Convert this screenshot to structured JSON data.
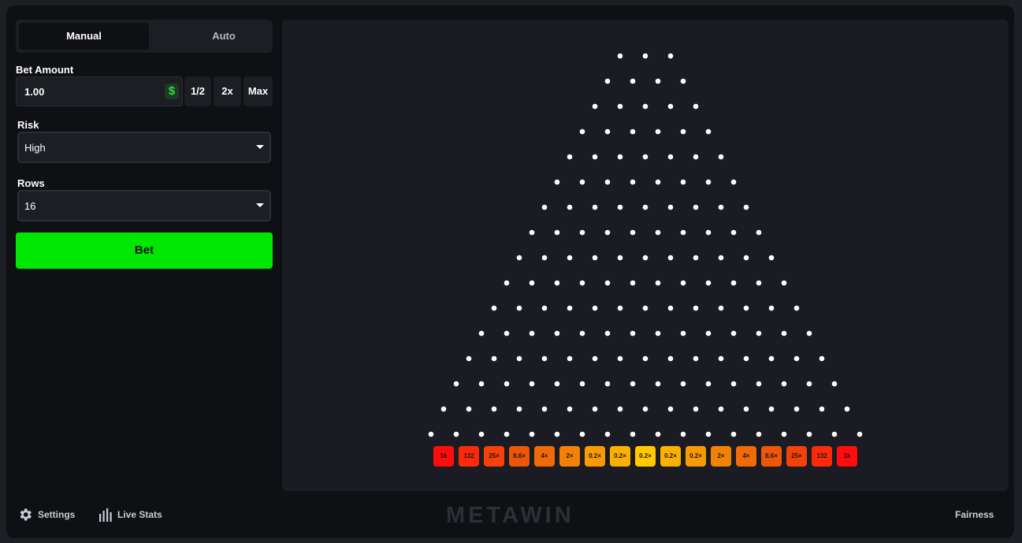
{
  "sidebar": {
    "tabs": {
      "manual": "Manual",
      "auto": "Auto"
    },
    "bet_amount": {
      "label": "Bet Amount",
      "value": "1.00",
      "currency_icon": "dollar-icon",
      "currency_symbol": "$"
    },
    "bet_buttons": {
      "half": "1/2",
      "double": "2x",
      "max": "Max"
    },
    "risk": {
      "label": "Risk",
      "value": "High"
    },
    "rows": {
      "label": "Rows",
      "value": "16"
    },
    "bet_button": "Bet"
  },
  "board": {
    "peg_rows": 16,
    "peg_color": "#ffffff",
    "buckets": [
      {
        "label": "1k",
        "color": "#ff0c0c"
      },
      {
        "label": "132",
        "color": "#fb2a0a"
      },
      {
        "label": "25×",
        "color": "#f54009"
      },
      {
        "label": "8.6×",
        "color": "#ef5608"
      },
      {
        "label": "4×",
        "color": "#f06a07"
      },
      {
        "label": "2×",
        "color": "#f38106"
      },
      {
        "label": "0.2×",
        "color": "#f89a05"
      },
      {
        "label": "0.2×",
        "color": "#fbb103"
      },
      {
        "label": "0.2×",
        "color": "#ffc802"
      },
      {
        "label": "0.2×",
        "color": "#fbb103"
      },
      {
        "label": "0.2×",
        "color": "#f89a05"
      },
      {
        "label": "2×",
        "color": "#f38106"
      },
      {
        "label": "4×",
        "color": "#f06a07"
      },
      {
        "label": "8.6×",
        "color": "#ef5608"
      },
      {
        "label": "25×",
        "color": "#f54009"
      },
      {
        "label": "132",
        "color": "#fb2a0a"
      },
      {
        "label": "1k",
        "color": "#ff0c0c"
      }
    ]
  },
  "footer": {
    "settings": "Settings",
    "settings_icon": "gear-icon",
    "live_stats": "Live Stats",
    "live_stats_icon": "bar-chart-icon",
    "logo": "METAWIN",
    "fairness": "Fairness"
  },
  "colors": {
    "accent": "#00e701",
    "panel": "#1c1e24",
    "background": "#0f1013",
    "board": "#1b1c23"
  }
}
